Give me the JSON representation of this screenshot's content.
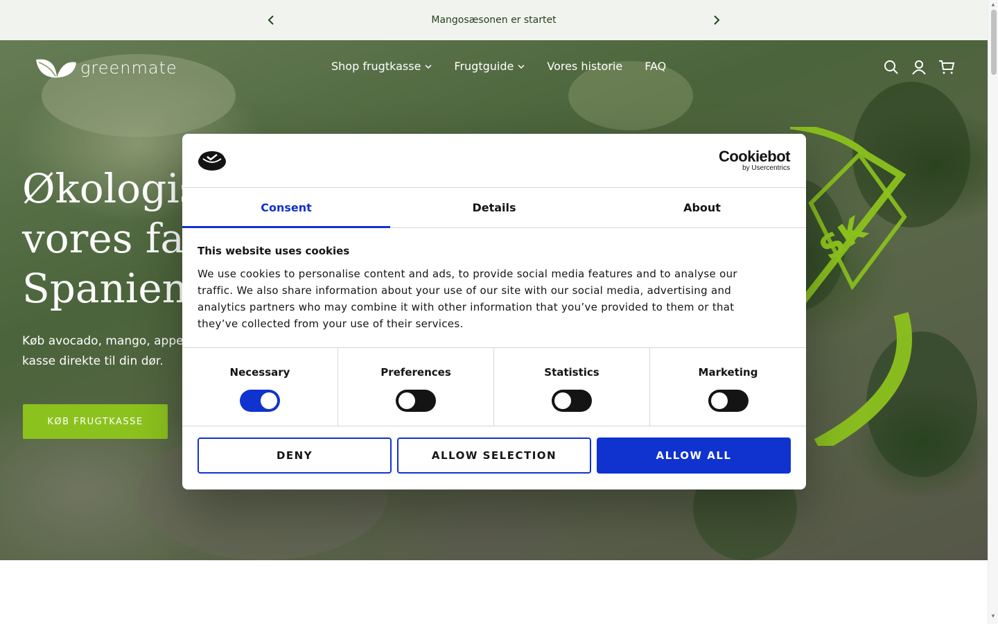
{
  "announcement": {
    "text": "Mangosæsonen er startet",
    "prev_icon": "chevron-left-icon",
    "next_icon": "chevron-right-icon"
  },
  "header": {
    "logo_text": "greenmate",
    "nav": [
      {
        "label": "Shop frugtkasse",
        "has_dropdown": true
      },
      {
        "label": "Frugtguide",
        "has_dropdown": true
      },
      {
        "label": "Vores historie",
        "has_dropdown": false
      },
      {
        "label": "FAQ",
        "has_dropdown": false
      }
    ],
    "icons": [
      "search-icon",
      "account-icon",
      "cart-icon"
    ]
  },
  "hero": {
    "title_line1": "Økologis",
    "title_line2": "vores far",
    "title_line3": "Spanien",
    "subtitle_line1": "Køb avocado, mango, appel",
    "subtitle_line2": "kasse direkte til din dør.",
    "cta_label": "KØB FRUGTKASSE",
    "stamp_text": "SK"
  },
  "cookie_dialog": {
    "brand": "Cookiebot",
    "brand_sub": "by Usercentrics",
    "tabs": [
      {
        "label": "Consent",
        "active": true
      },
      {
        "label": "Details",
        "active": false
      },
      {
        "label": "About",
        "active": false
      }
    ],
    "heading": "This website uses cookies",
    "body": "We use cookies to personalise content and ads, to provide social media features and to analyse our traffic. We also share information about your use of our site with our social media, advertising and analytics partners who may combine it with other information that you’ve provided to them or that they’ve collected from your use of their services.",
    "categories": [
      {
        "label": "Necessary",
        "enabled": true
      },
      {
        "label": "Preferences",
        "enabled": false
      },
      {
        "label": "Statistics",
        "enabled": false
      },
      {
        "label": "Marketing",
        "enabled": false
      }
    ],
    "buttons": {
      "deny": "DENY",
      "allow_selection": "ALLOW SELECTION",
      "allow_all": "ALLOW ALL"
    }
  },
  "colors": {
    "accent_blue": "#1032cf",
    "cta_green": "#8cc21e",
    "announce_bg": "#f1f4ee"
  }
}
